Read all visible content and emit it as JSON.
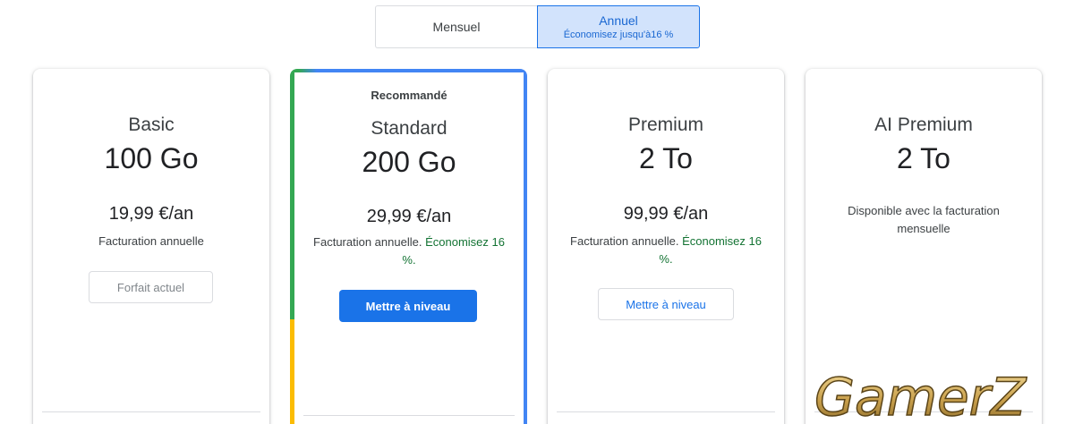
{
  "billing_toggle": {
    "monthly_label": "Mensuel",
    "annual_label": "Annuel",
    "annual_sub": "Économisez jusqu'à16 %",
    "selected": "annual"
  },
  "plans": [
    {
      "name": "Basic",
      "storage": "100 Go",
      "price": "19,99 €/an",
      "billing": "Facturation annuelle",
      "button": "Forfait actuel"
    },
    {
      "badge": "Recommandé",
      "name": "Standard",
      "storage": "200 Go",
      "price": "29,99 €/an",
      "billing": "Facturation annuelle.",
      "savings": "Économisez 16 %.",
      "button": "Mettre à niveau"
    },
    {
      "name": "Premium",
      "storage": "2 To",
      "price": "99,99 €/an",
      "billing": "Facturation annuelle.",
      "savings": "Économisez 16 %.",
      "button": "Mettre à niveau"
    },
    {
      "name": "AI Premium",
      "storage": "2 To",
      "availability": "Disponible avec la facturation mensuelle"
    }
  ],
  "watermark": "GamerZ",
  "colors": {
    "accent": "#1a73e8",
    "selected_bg": "#d2e3fc",
    "savings_green": "#137333",
    "frame_green": "#34a853",
    "frame_yellow": "#fbbc04",
    "frame_blue": "#4285f4"
  }
}
